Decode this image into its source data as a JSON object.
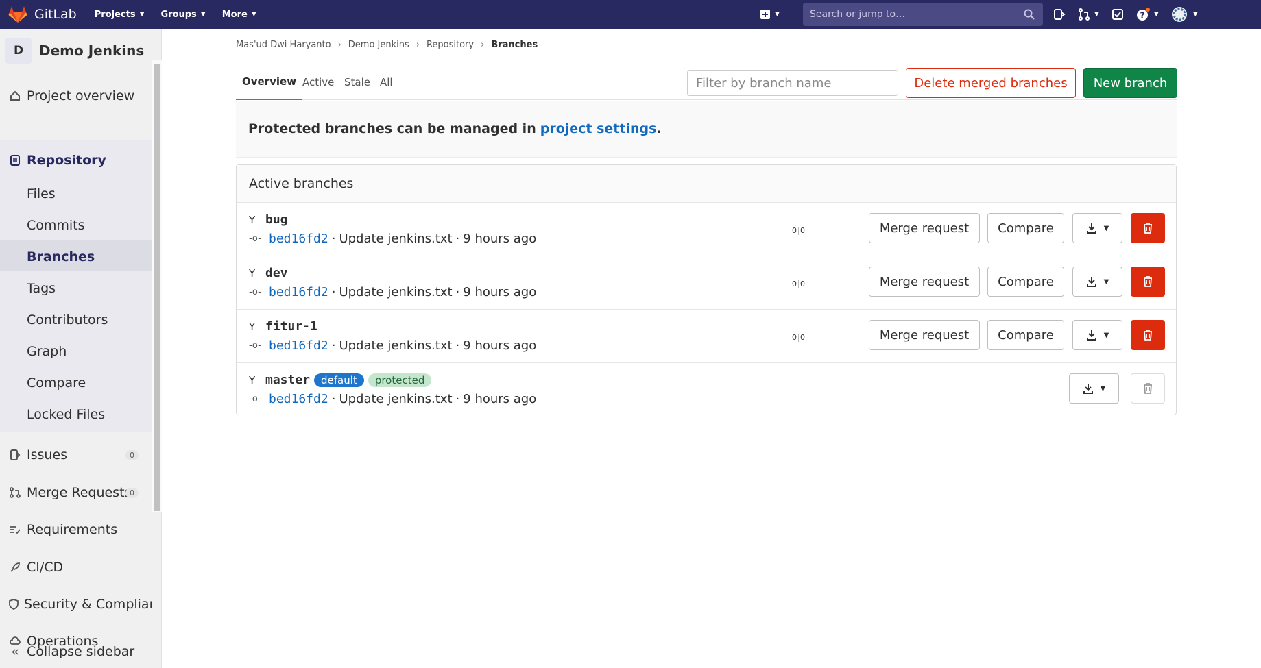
{
  "topbar": {
    "brand": "GitLab",
    "nav": [
      "Projects",
      "Groups",
      "More"
    ],
    "search_placeholder": "Search or jump to…",
    "icons": [
      "plus-square-icon",
      "issues-icon",
      "merge-request-icon",
      "todo-icon",
      "help-icon",
      "avatar"
    ]
  },
  "sidebar": {
    "project_initial": "D",
    "project_name": "Demo Jenkins",
    "items": {
      "overview": "Project overview",
      "repository": "Repository",
      "files": "Files",
      "commits": "Commits",
      "branches": "Branches",
      "tags": "Tags",
      "contributors": "Contributors",
      "graph": "Graph",
      "compare": "Compare",
      "locked_files": "Locked Files",
      "issues": "Issues",
      "issues_count": "0",
      "merge_requests": "Merge Requests",
      "merge_requests_count": "0",
      "requirements": "Requirements",
      "cicd": "CI/CD",
      "security": "Security & Complianc",
      "operations": "Operations",
      "collapse": "Collapse sidebar"
    }
  },
  "breadcrumb": [
    "Mas'ud Dwi Haryanto",
    "Demo Jenkins",
    "Repository",
    "Branches"
  ],
  "tabs": [
    "Overview",
    "Active",
    "Stale",
    "All"
  ],
  "filter_placeholder": "Filter by branch name",
  "buttons": {
    "delete_merged": "Delete merged branches",
    "new_branch": "New branch",
    "merge_request": "Merge request",
    "compare": "Compare"
  },
  "notice": {
    "text": "Protected branches can be managed in",
    "link": "project settings",
    "end": "."
  },
  "panel_title": "Active branches",
  "branches": [
    {
      "name": "bug",
      "sha": "bed16fd2",
      "message": "Update jenkins.txt",
      "time": "9 hours ago",
      "behind": "0",
      "ahead": "0"
    },
    {
      "name": "dev",
      "sha": "bed16fd2",
      "message": "Update jenkins.txt",
      "time": "9 hours ago",
      "behind": "0",
      "ahead": "0"
    },
    {
      "name": "fitur-1",
      "sha": "bed16fd2",
      "message": "Update jenkins.txt",
      "time": "9 hours ago",
      "behind": "0",
      "ahead": "0"
    },
    {
      "name": "master",
      "sha": "bed16fd2",
      "message": "Update jenkins.txt",
      "time": "9 hours ago",
      "badges": [
        "default",
        "protected"
      ]
    }
  ],
  "colors": {
    "topbar": "#292961",
    "link": "#1068bf",
    "danger": "#dd2b0e",
    "success": "#108548"
  }
}
